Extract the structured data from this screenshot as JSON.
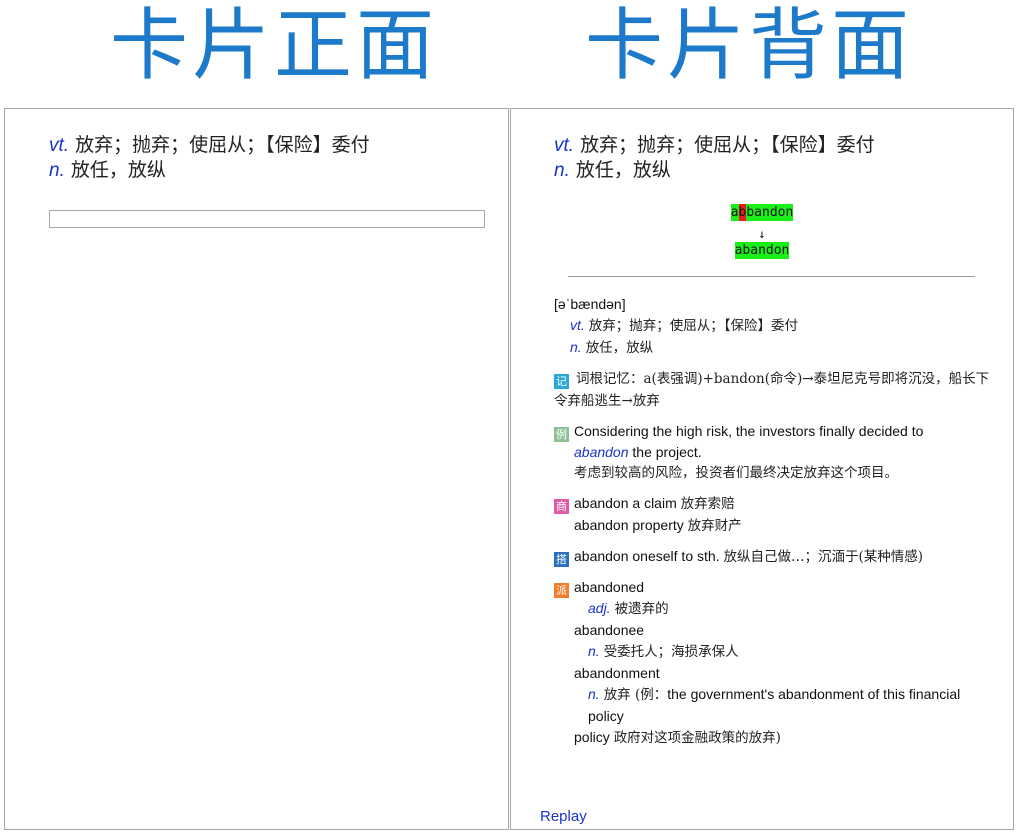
{
  "titles": {
    "front": "卡片正面",
    "back": "卡片背面"
  },
  "definition": {
    "vt_pos": "vt.",
    "vt_text": "放弃；抛弃；使屈从；【保险】委付",
    "n_pos": "n.",
    "n_text": "放任，放纵"
  },
  "answer_input": {
    "value": "",
    "placeholder": ""
  },
  "comparison": {
    "typed_part1": "a",
    "typed_wrong": "b",
    "typed_part2": "bandon",
    "arrow": "↓",
    "correct": "abandon"
  },
  "detail": {
    "phonetic": "[əˈbændən]",
    "def_vt_pos": "vt.",
    "def_vt_text": "放弃；抛弃；使屈从；【保险】委付",
    "def_n_pos": "n.",
    "def_n_text": "放任，放纵",
    "memory_tag": "记",
    "memory_text": "词根记忆：a(表强调)+bandon(命令)→泰坦尼克号即将沉没，船长下令弃船逃生→放弃",
    "example_tag": "例",
    "example_en_1": "Considering the high risk, the investors finally decided to",
    "example_word": "abandon",
    "example_en_2": "the project.",
    "example_cn": "考虑到较高的风险，投资者们最终决定放弃这个项目。",
    "business_tag": "商",
    "business_1_en": "abandon a claim",
    "business_1_cn": "放弃索赔",
    "business_2_en": "abandon property",
    "business_2_cn": "放弃财产",
    "collocation_tag": "搭",
    "collocation_en": "abandon oneself to sth.",
    "collocation_cn": "放纵自己做…；沉湎于(某种情感)",
    "derived_tag": "派",
    "derived_1_word": "abandoned",
    "derived_1_pos": "adj.",
    "derived_1_cn": "被遗弃的",
    "derived_2_word": "abandonee",
    "derived_2_pos": "n.",
    "derived_2_cn": "受委托人；海损承保人",
    "derived_3_word": "abandonment",
    "derived_3_pos": "n.",
    "derived_3_cn_a": "放弃 (例：",
    "derived_3_en": "the government's abandonment of this financial policy",
    "derived_3_cn_b": "政府对这项金融政策的放弃)"
  },
  "replay_label": "Replay",
  "colors": {
    "title": "#1d79c9",
    "pos": "#1a33cc",
    "match": "#19f019",
    "mismatch": "#ee1b1b"
  }
}
